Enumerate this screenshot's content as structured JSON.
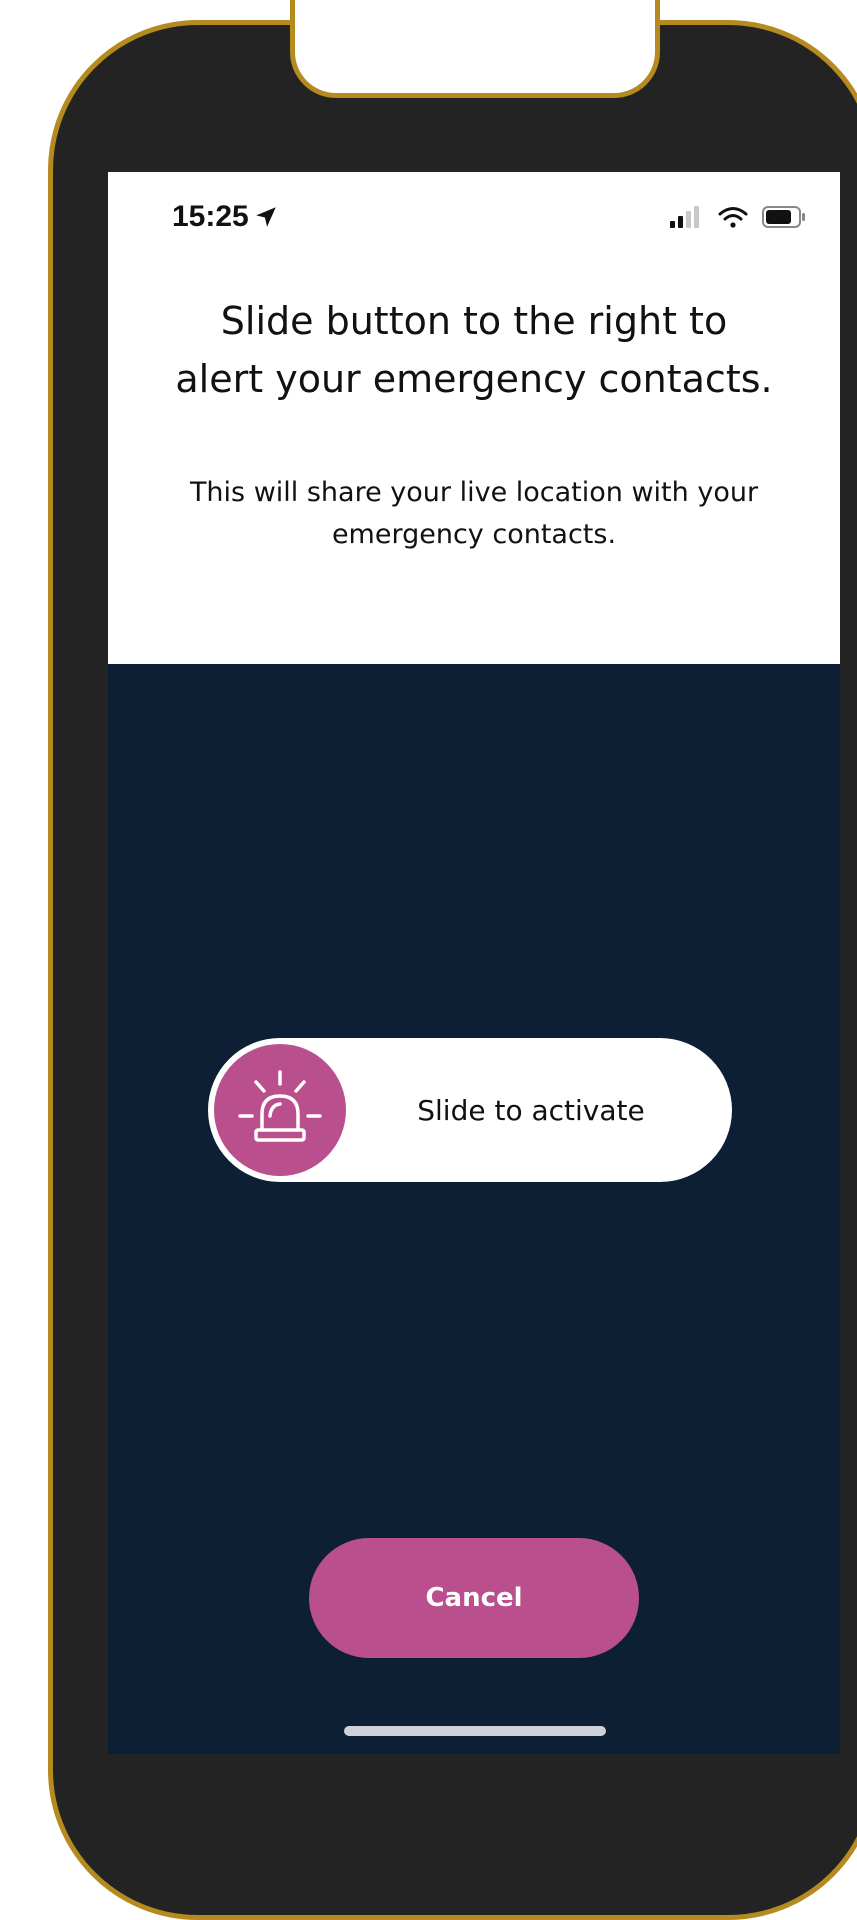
{
  "status_bar": {
    "time": "15:25",
    "location_icon": "location-arrow-icon",
    "signal_icon": "cellular-signal-icon",
    "wifi_icon": "wifi-icon",
    "battery_icon": "battery-icon"
  },
  "prompt": {
    "headline_line1": "Slide button to the right to",
    "headline_line2": "alert your emergency contacts.",
    "subtext_line1": "This will share your live location with your",
    "subtext_line2": "emergency contacts."
  },
  "slider": {
    "label": "Slide to activate",
    "knob_icon": "siren-icon"
  },
  "actions": {
    "cancel_label": "Cancel"
  },
  "colors": {
    "accent": "#b94f8c",
    "dark_background": "#0d1f35",
    "frame_gold": "#b58a1e"
  }
}
